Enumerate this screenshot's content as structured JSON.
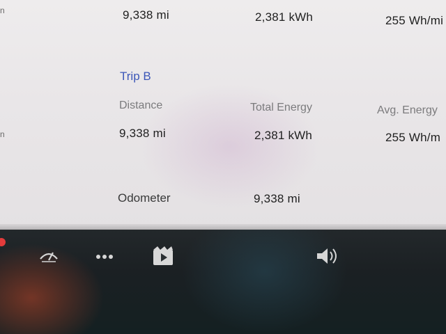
{
  "trip_a": {
    "distance": "9,338  mi",
    "total_energy": "2,381 kWh",
    "avg_energy": "255 Wh/mi"
  },
  "trip_b": {
    "title": "Trip B",
    "distance_label": "Distance",
    "total_energy_label": "Total Energy",
    "avg_energy_label": "Avg. Energy",
    "distance": "9,338  mi",
    "total_energy": "2,381 kWh",
    "avg_energy": "255 Wh/m"
  },
  "odometer": {
    "label": "Odometer",
    "value": "9,338  mi"
  },
  "taskbar": {
    "icons": [
      "wiper-icon",
      "apps-icon",
      "media-player-icon",
      "volume-icon"
    ]
  },
  "colors": {
    "section_title": "#3c57b8",
    "label": "#7b7b7d",
    "value": "#1f1f1f"
  }
}
